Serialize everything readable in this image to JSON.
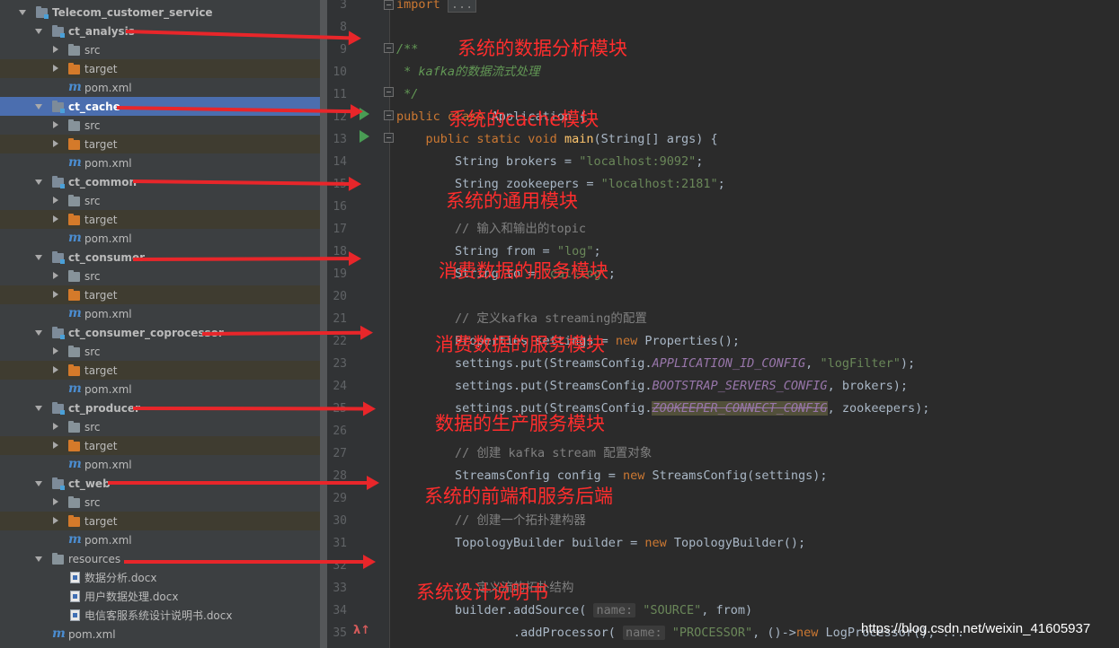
{
  "tree": {
    "root": "Telecom_customer_service",
    "modules": [
      {
        "name": "ct_analysis",
        "children": [
          "src",
          "target",
          "pom.xml"
        ]
      },
      {
        "name": "ct_cache",
        "children": [
          "src",
          "target",
          "pom.xml"
        ]
      },
      {
        "name": "ct_common",
        "children": [
          "src",
          "target",
          "pom.xml"
        ]
      },
      {
        "name": "ct_consumer",
        "children": [
          "src",
          "target",
          "pom.xml"
        ]
      },
      {
        "name": "ct_consumer_coprocessor",
        "children": [
          "src",
          "target",
          "pom.xml"
        ]
      },
      {
        "name": "ct_producer",
        "children": [
          "src",
          "target",
          "pom.xml"
        ]
      },
      {
        "name": "ct_web",
        "children": [
          "src",
          "target",
          "pom.xml"
        ]
      }
    ],
    "resources": {
      "name": "resources",
      "files": [
        "数据分析.docx",
        "用户数据处理.docx",
        "电信客服系统设计说明书.docx"
      ]
    },
    "root_pom": "pom.xml",
    "selected_module": "ct_cache"
  },
  "editor": {
    "line_numbers": [
      "3",
      "8",
      "9",
      "10",
      "11",
      "12",
      "13",
      "14",
      "15",
      "16",
      "17",
      "18",
      "19",
      "20",
      "21",
      "22",
      "23",
      "24",
      "25",
      "26",
      "27",
      "28",
      "29",
      "30",
      "31",
      "32",
      "33",
      "34",
      "35"
    ]
  },
  "annotations": [
    "系统的数据分析模块",
    "系统的cache模块",
    "系统的通用模块",
    "消费数据的服务模块",
    "消费数据的服务模块",
    "数据的生产服务模块",
    "系统的前端和服务后端",
    "系统设计说明书"
  ],
  "watermark": "https://blog.csdn.net/weixin_41605937",
  "colors": {
    "annotation": "#e8262a",
    "selection": "#4b6eaf",
    "run_icon": "#499c54"
  }
}
